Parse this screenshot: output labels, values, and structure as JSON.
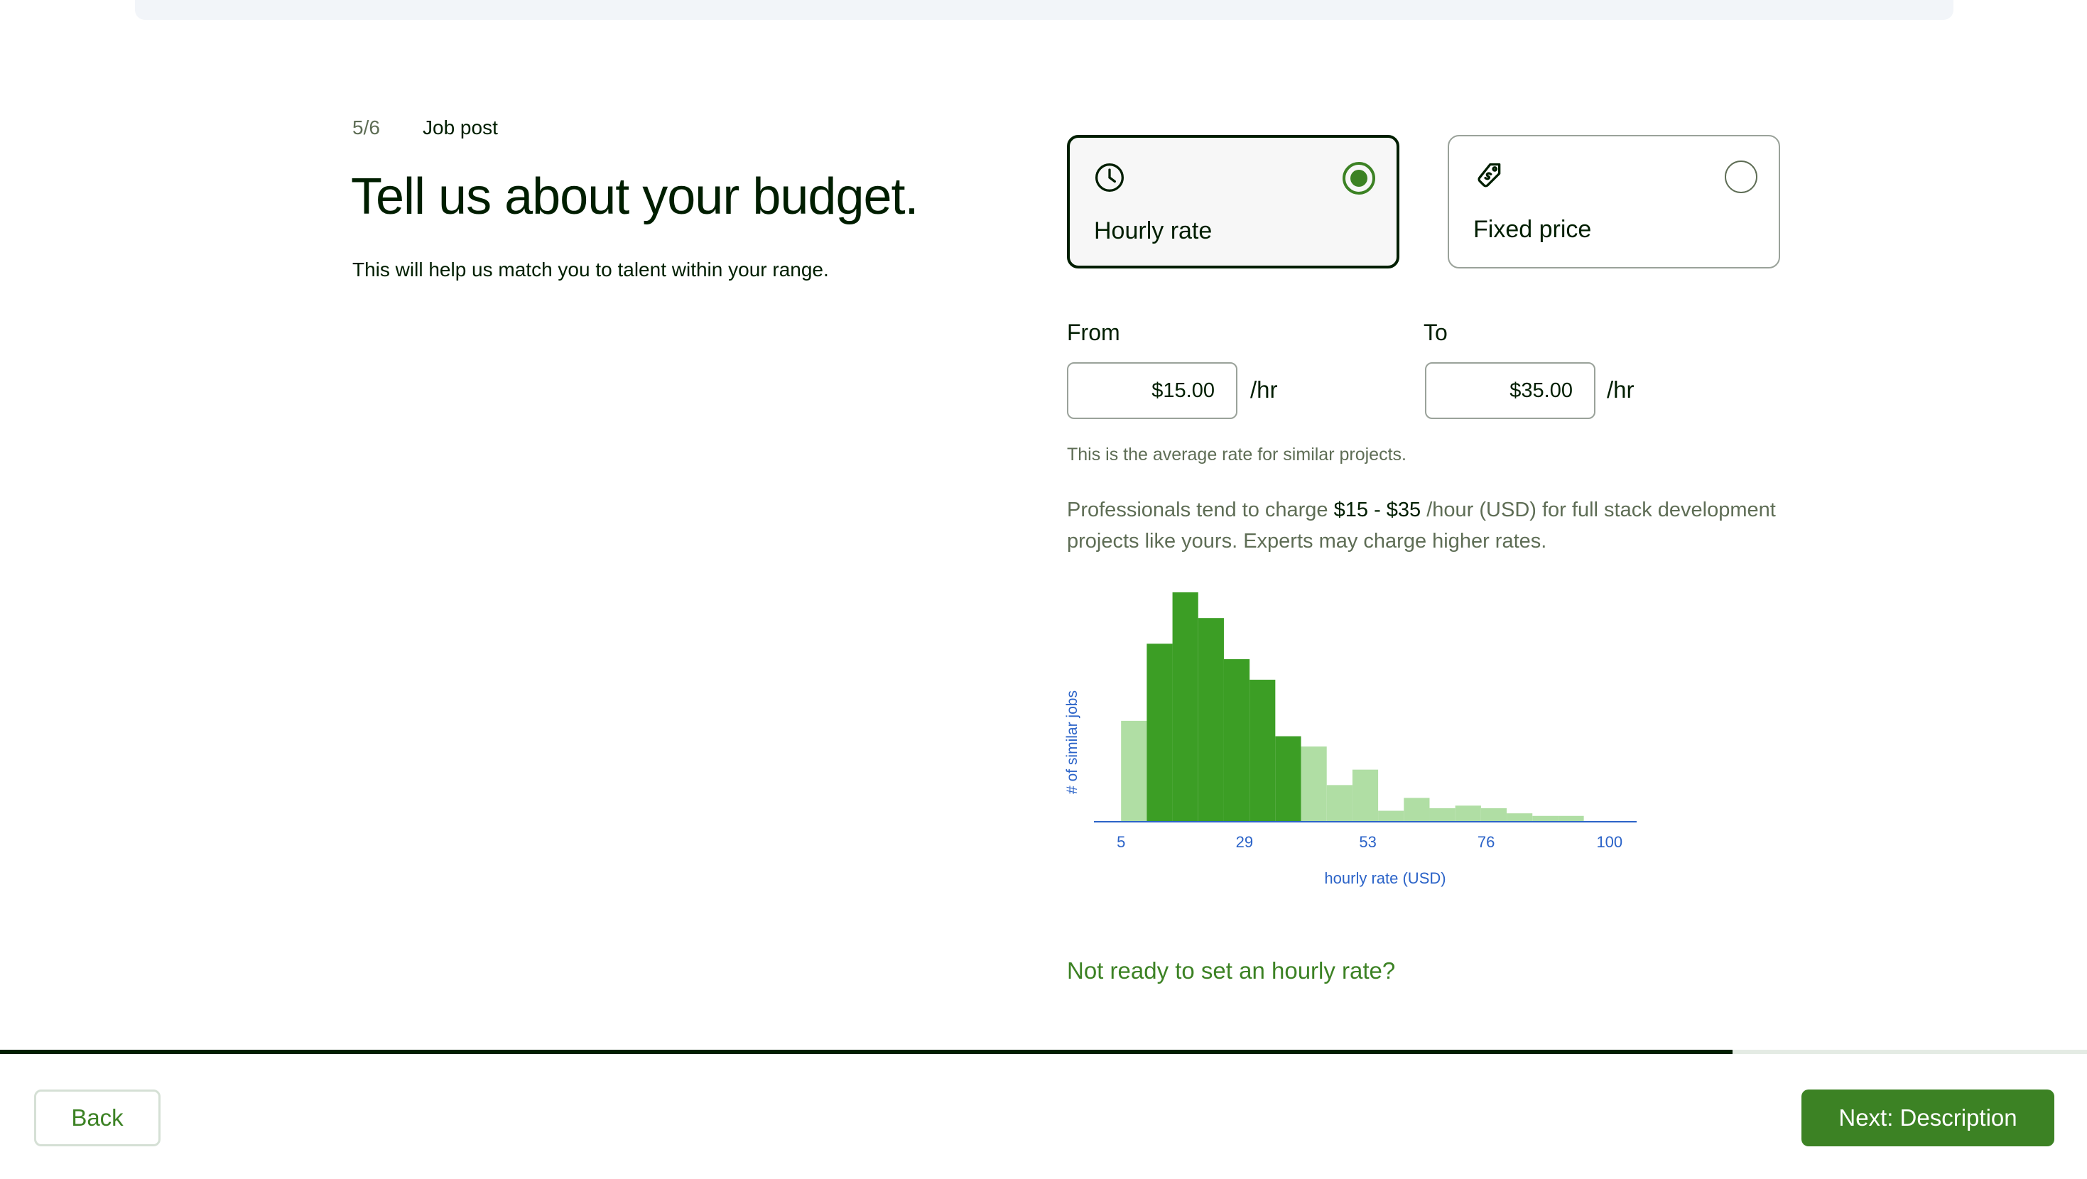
{
  "step": {
    "counter": "5/6",
    "title": "Job post"
  },
  "headline": "Tell us about your budget.",
  "subheadline": "This will help us match you to talent within your range.",
  "budget_types": [
    {
      "label": "Hourly rate",
      "icon": "clock-icon",
      "selected": true
    },
    {
      "label": "Fixed price",
      "icon": "price-tag-icon",
      "selected": false
    }
  ],
  "rate": {
    "from_label": "From",
    "from_value": "$15.00",
    "to_label": "To",
    "to_value": "$35.00",
    "unit": "/hr"
  },
  "average_note": "This is the average rate for similar projects.",
  "professionals_note": {
    "prefix": "Professionals tend to charge ",
    "range": "$15 - $35",
    "suffix": " /hour (USD) for full stack development projects like yours. Experts may charge higher rates."
  },
  "chart_data": {
    "type": "bar",
    "xlabel": "hourly rate (USD)",
    "ylabel": "# of similar jobs",
    "x_ticks": [
      5,
      29,
      53,
      76,
      100
    ],
    "bin_edges": [
      5,
      10,
      15,
      20,
      25,
      30,
      35,
      40,
      45,
      50,
      55,
      60,
      65,
      70,
      75,
      80,
      85,
      90,
      95,
      100
    ],
    "values": [
      39,
      69,
      89,
      79,
      63,
      55,
      33,
      29,
      14,
      20,
      4,
      9,
      5,
      6,
      5,
      3,
      2,
      2,
      0
    ],
    "highlight_range": [
      10,
      40
    ],
    "colors": {
      "highlight": "#3c9e25",
      "other": "#b0dea4",
      "axis": "#2b63c8"
    }
  },
  "not_ready_link": "Not ready to set an hourly rate?",
  "progress_percent": 83,
  "footer": {
    "back_label": "Back",
    "next_label": "Next: Description"
  }
}
